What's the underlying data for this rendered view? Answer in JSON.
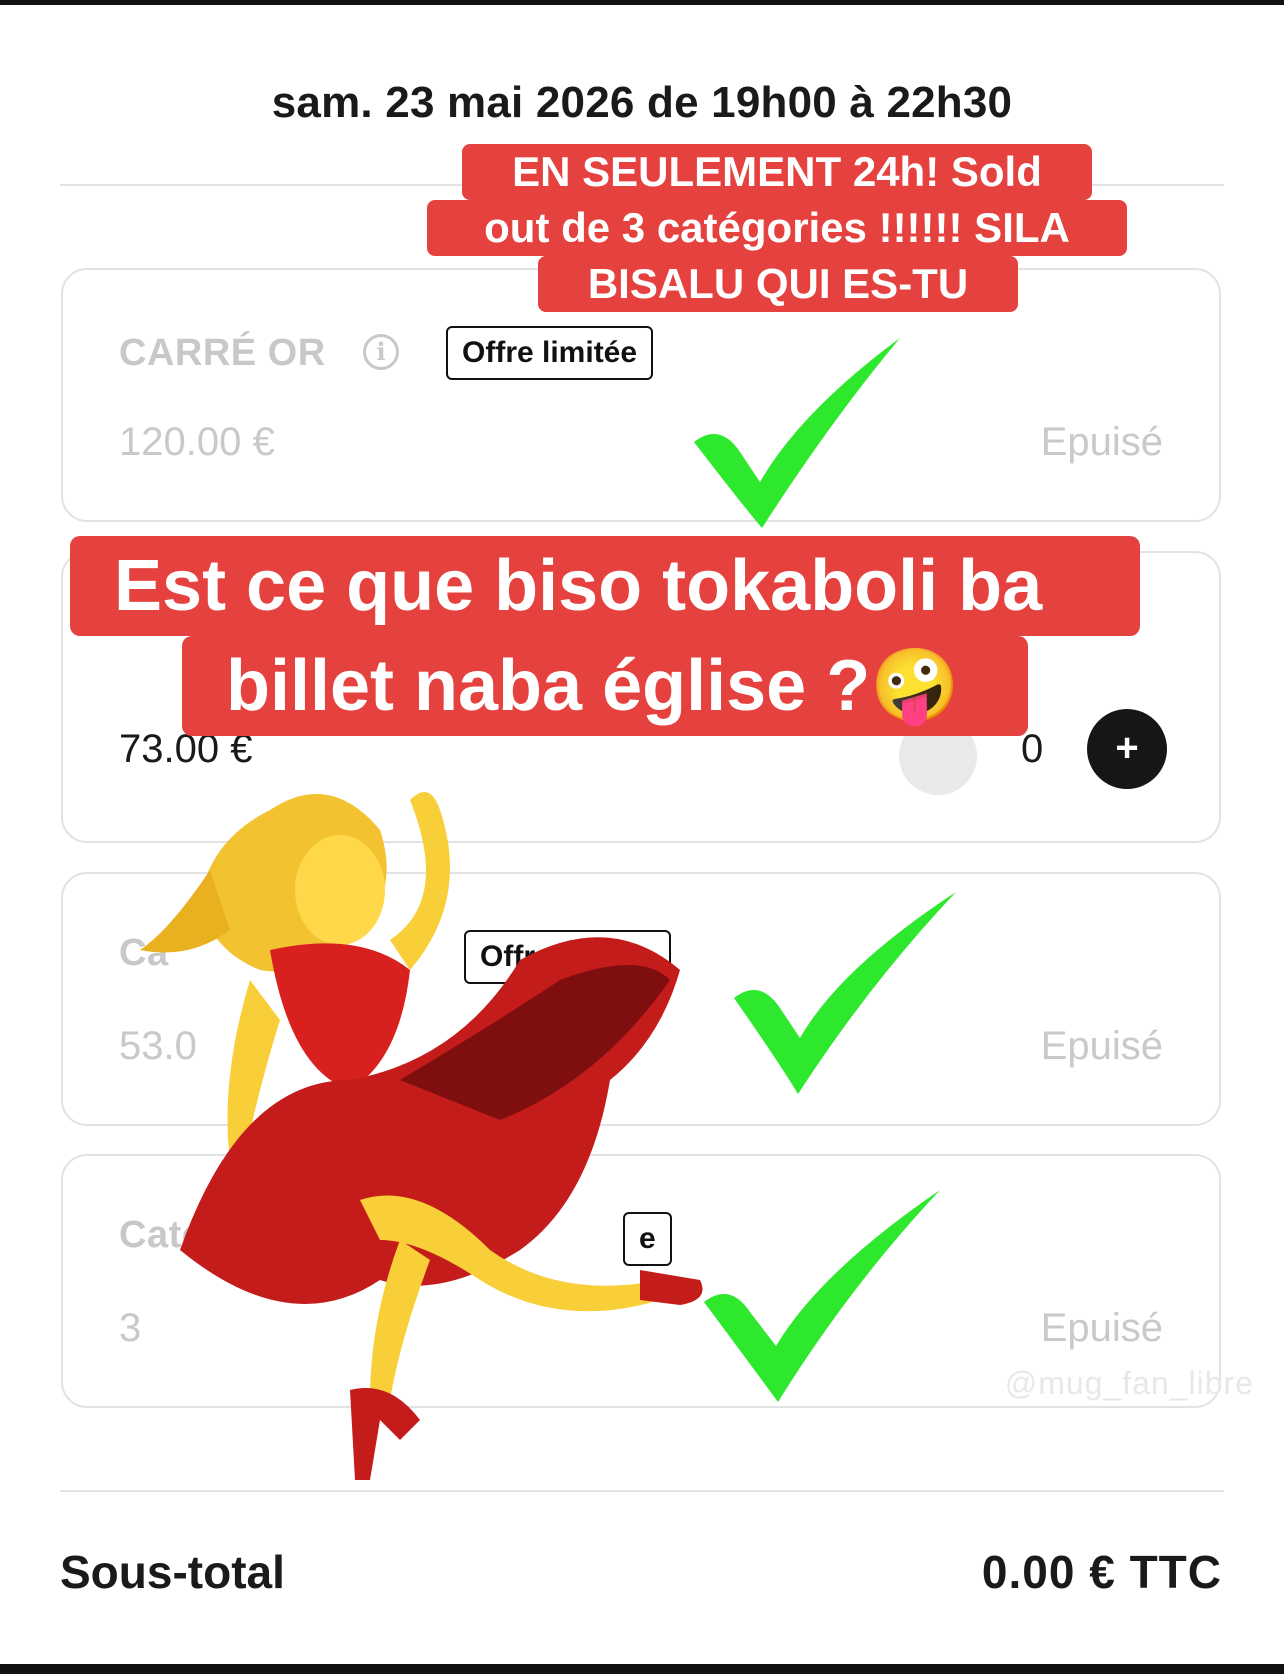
{
  "event": {
    "date_line": "sam. 23 mai 2026 de 19h00 à 22h30"
  },
  "tickets": [
    {
      "name": "CARRÉ OR",
      "badge": "Offre limitée",
      "price": "120.00 €",
      "status": "Epuisé"
    },
    {
      "price": "73.00 €",
      "quantity": "0",
      "plus_label": "+"
    },
    {
      "name": "Ca",
      "badge": "Offre limitée",
      "price": "53.0",
      "status": "Epuisé"
    },
    {
      "name": "Categori",
      "badge": "e",
      "price": "3",
      "status": "Epuisé"
    }
  ],
  "subtotal": {
    "label": "Sous-total",
    "value": "0.00 € TTC"
  },
  "overlay": {
    "caption_top": [
      "EN SEULEMENT 24h! Sold",
      "out de 3 catégories !!!!!! SILA",
      "BISALU QUI ES-TU"
    ],
    "caption_main": [
      "Est ce que biso tokaboli ba",
      "billet naba église ?🤪"
    ],
    "watermark": "@mug_fan_libre",
    "check_color": "#2ee82e",
    "caption_color": "#e5413e"
  }
}
